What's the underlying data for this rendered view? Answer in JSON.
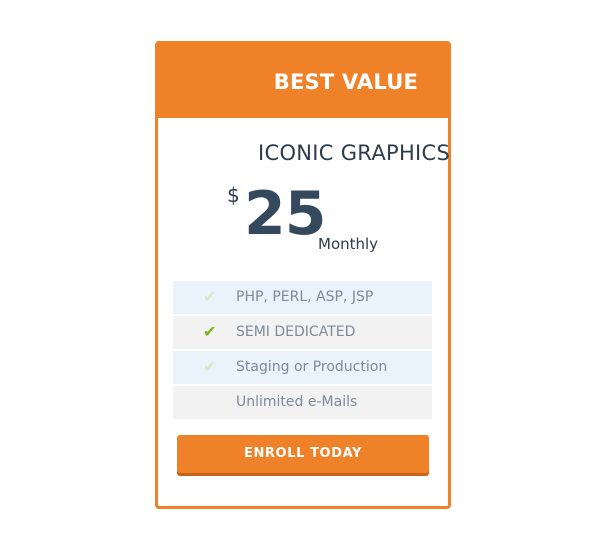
{
  "card": {
    "badge": "BEST VALUE",
    "plan_name": "ICONIC GRAPHICS",
    "price": {
      "currency": "$",
      "amount": "25",
      "period": "Monthly"
    },
    "features": [
      {
        "label": "PHP, PERL, ASP, JSP",
        "icon": "check-icon",
        "state": "faded"
      },
      {
        "label": "SEMI DEDICATED",
        "icon": "check-icon",
        "state": "active"
      },
      {
        "label": "Staging or Production",
        "icon": "check-icon",
        "state": "faded"
      },
      {
        "label": "Unlimited e-Mails",
        "icon": "",
        "state": "none"
      }
    ],
    "cta": "ENROLL TODAY"
  },
  "colors": {
    "accent": "#ef8228",
    "price": "#34495e",
    "check_active": "#7bb51b",
    "check_faded": "#d6e8c6",
    "row_blue": "#eaf3fb",
    "row_grey": "#f2f2f2"
  }
}
